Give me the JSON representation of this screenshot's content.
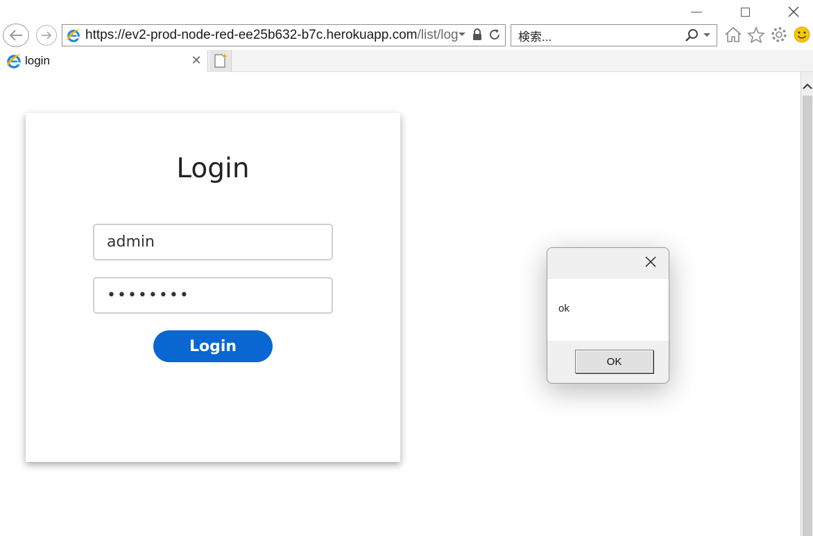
{
  "window": {
    "controls": [
      "minimize",
      "maximize",
      "close"
    ]
  },
  "navigation": {
    "back_icon": "back-arrow-icon",
    "forward_icon": "forward-arrow-icon"
  },
  "addressbar": {
    "url_main": "https://ev2-prod-node-red-ee25b632-b7c.herokuapp.com",
    "url_path": "/list/log",
    "icons": [
      "dropdown-arrow-icon",
      "lock-icon",
      "refresh-icon"
    ]
  },
  "search": {
    "placeholder": "検索..."
  },
  "toolbar": {
    "icons": [
      "home-icon",
      "favorites-star-icon",
      "settings-gear-icon",
      "feedback-smiley-icon"
    ]
  },
  "tabs": [
    {
      "label": "login",
      "active": true
    }
  ],
  "login": {
    "title": "Login",
    "username_value": "admin",
    "password_value": "••••••••",
    "button_label": "Login"
  },
  "dialog": {
    "message": "ok",
    "ok_label": "OK"
  },
  "colors": {
    "accent": "#0a66d0",
    "ie_blue": "#1e88e5",
    "ie_gold": "#f4b400"
  }
}
